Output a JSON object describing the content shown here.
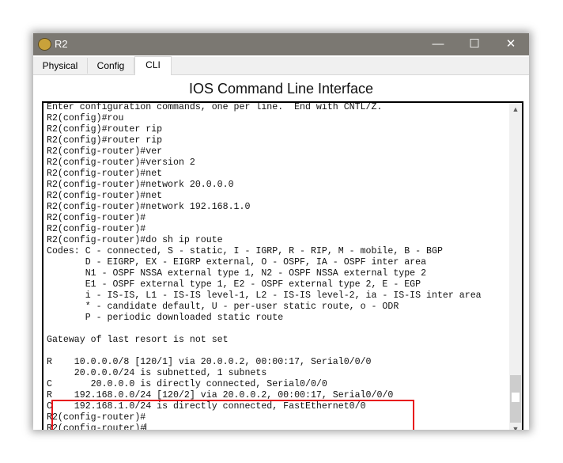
{
  "window": {
    "title": "R2",
    "app_icon": "packet-tracer-router-icon",
    "controls": [
      "minimize-icon",
      "maximize-icon",
      "close-icon"
    ]
  },
  "tabs": [
    {
      "label": "Physical"
    },
    {
      "label": "Config"
    },
    {
      "label": "CLI",
      "active": true
    }
  ],
  "heading": "IOS Command Line Interface",
  "terminal": {
    "lines": [
      "Enter configuration commands, one per line.  End with CNTL/Z.",
      "R2(config)#rou",
      "R2(config)#router rip",
      "R2(config)#router rip",
      "R2(config-router)#ver",
      "R2(config-router)#version 2",
      "R2(config-router)#net",
      "R2(config-router)#network 20.0.0.0",
      "R2(config-router)#net",
      "R2(config-router)#network 192.168.1.0",
      "R2(config-router)#",
      "R2(config-router)#",
      "R2(config-router)#do sh ip route",
      "Codes: C - connected, S - static, I - IGRP, R - RIP, M - mobile, B - BGP",
      "       D - EIGRP, EX - EIGRP external, O - OSPF, IA - OSPF inter area",
      "       N1 - OSPF NSSA external type 1, N2 - OSPF NSSA external type 2",
      "       E1 - OSPF external type 1, E2 - OSPF external type 2, E - EGP",
      "       i - IS-IS, L1 - IS-IS level-1, L2 - IS-IS level-2, ia - IS-IS inter area",
      "       * - candidate default, U - per-user static route, o - ODR",
      "       P - periodic downloaded static route",
      "",
      "Gateway of last resort is not set",
      "",
      "R    10.0.0.0/8 [120/1] via 20.0.0.2, 00:00:17, Serial0/0/0",
      "     20.0.0.0/24 is subnetted, 1 subnets",
      "C       20.0.0.0 is directly connected, Serial0/0/0",
      "R    192.168.0.0/24 [120/2] via 20.0.0.2, 00:00:17, Serial0/0/0",
      "C    192.168.1.0/24 is directly connected, FastEthernet0/0",
      "R2(config-router)#",
      "R2(config-router)#"
    ],
    "highlight_color": "#e8151b"
  }
}
